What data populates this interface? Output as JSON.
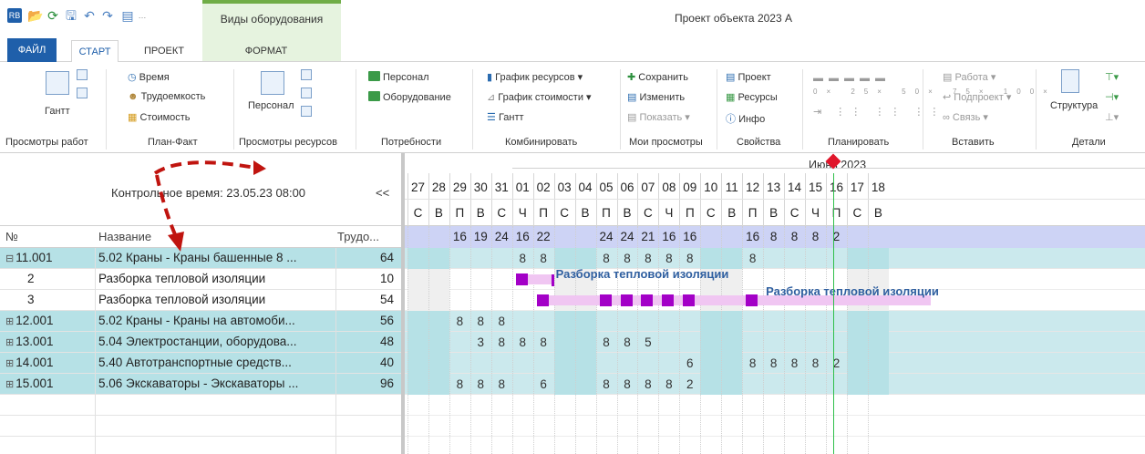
{
  "title_bar": {
    "context_tab_group": "Виды оборудования",
    "document_title": "Проект объекта 2023 А"
  },
  "tabs": [
    "ФАЙЛ",
    "СТАРТ",
    "ПРОЕКТ",
    "ФОРМАТ"
  ],
  "ribbon": {
    "work_views": {
      "gantt": "Гантт",
      "group": "Просмотры работ"
    },
    "plan_fact": {
      "time": "Время",
      "labor": "Трудоемкость",
      "cost": "Стоимость",
      "group": "План-Факт"
    },
    "resource_views": {
      "personnel": "Персонал",
      "group": "Просмотры ресурсов"
    },
    "needs": {
      "personnel": "Персонал",
      "equipment": "Оборудование",
      "group": "Потребности"
    },
    "combine": {
      "resource_chart": "График ресурсов",
      "cost_chart": "График стоимости",
      "gantt": "Гантт",
      "group": "Комбинировать"
    },
    "my_views": {
      "save": "Сохранить",
      "edit": "Изменить",
      "show": "Показать",
      "group": "Мои просмотры"
    },
    "properties": {
      "project": "Проект",
      "resources": "Ресурсы",
      "info": "Инфо",
      "group": "Свойства"
    },
    "planning": {
      "percents": [
        "0×",
        "25×",
        "50×",
        "75×",
        "100×"
      ],
      "group": "Планировать"
    },
    "insert": {
      "task": "Работа",
      "subproject": "Подпроект",
      "link": "Связь",
      "group": "Вставить"
    },
    "details": {
      "structure": "Структура",
      "group": "Детали"
    }
  },
  "grid_header": {
    "control_time": "Контрольное время: 23.05.23 08:00",
    "collapse": "<<",
    "col_num": "№",
    "col_name": "Название",
    "col_labor": "Трудо...",
    "month": "Июнь 2023"
  },
  "rows": [
    {
      "num": "11.001",
      "name": "5.02 Краны - Краны башенные 8 ...",
      "labor": "64",
      "group": true
    },
    {
      "num": "2",
      "name": "Разборка тепловой изоляции",
      "labor": "10",
      "group": false
    },
    {
      "num": "3",
      "name": "Разборка тепловой изоляции",
      "labor": "54",
      "group": false
    },
    {
      "num": "12.001",
      "name": "5.02 Краны - Краны на автомоби...",
      "labor": "56",
      "group": true
    },
    {
      "num": "13.001",
      "name": "5.04 Электростанции, оборудова...",
      "labor": "48",
      "group": true
    },
    {
      "num": "14.001",
      "name": "5.40 Автотранспортные средств...",
      "labor": "40",
      "group": true
    },
    {
      "num": "15.001",
      "name": "5.06 Экскаваторы - Экскаваторы ...",
      "labor": "96",
      "group": true
    }
  ],
  "days": [
    {
      "d": "27",
      "w": "С",
      "we": true
    },
    {
      "d": "28",
      "w": "В",
      "we": true
    },
    {
      "d": "29",
      "w": "П",
      "we": false
    },
    {
      "d": "30",
      "w": "В",
      "we": false
    },
    {
      "d": "31",
      "w": "С",
      "we": false
    },
    {
      "d": "01",
      "w": "Ч",
      "we": false
    },
    {
      "d": "02",
      "w": "П",
      "we": false
    },
    {
      "d": "03",
      "w": "С",
      "we": true
    },
    {
      "d": "04",
      "w": "В",
      "we": true
    },
    {
      "d": "05",
      "w": "П",
      "we": false
    },
    {
      "d": "06",
      "w": "В",
      "we": false
    },
    {
      "d": "07",
      "w": "С",
      "we": false
    },
    {
      "d": "08",
      "w": "Ч",
      "we": false
    },
    {
      "d": "09",
      "w": "П",
      "we": false
    },
    {
      "d": "10",
      "w": "С",
      "we": true
    },
    {
      "d": "11",
      "w": "В",
      "we": true
    },
    {
      "d": "12",
      "w": "П",
      "we": false
    },
    {
      "d": "13",
      "w": "В",
      "we": false
    },
    {
      "d": "14",
      "w": "С",
      "we": false
    },
    {
      "d": "15",
      "w": "Ч",
      "we": false
    },
    {
      "d": "16",
      "w": "П",
      "we": false
    },
    {
      "d": "17",
      "w": "С",
      "we": true
    },
    {
      "d": "18",
      "w": "В",
      "we": true
    }
  ],
  "totals": [
    "",
    "",
    "16",
    "19",
    "24",
    "16",
    "22",
    "",
    "",
    "24",
    "24",
    "21",
    "16",
    "16",
    "",
    "",
    "16",
    "8",
    "8",
    "8",
    "2",
    "",
    ""
  ],
  "row_values": [
    [
      "",
      "",
      "",
      "",
      "",
      "8",
      "8",
      "",
      "",
      "8",
      "8",
      "8",
      "8",
      "8",
      "",
      "",
      "8",
      "",
      "",
      "",
      "",
      "",
      ""
    ],
    [],
    [],
    [
      "",
      "",
      "8",
      "8",
      "8",
      "",
      "",
      "",
      "",
      "",
      "",
      "",
      "",
      "",
      "",
      "",
      "",
      "",
      "",
      "",
      "",
      "",
      ""
    ],
    [
      "",
      "",
      "",
      "3",
      "8",
      "8",
      "8",
      "",
      "",
      "8",
      "8",
      "5",
      "",
      "",
      "",
      "",
      "",
      "",
      "",
      "",
      "",
      "",
      ""
    ],
    [
      "",
      "",
      "",
      "",
      "",
      "",
      "",
      "",
      "",
      "",
      "",
      "",
      "",
      "6",
      "",
      "",
      "8",
      "8",
      "8",
      "8",
      "2",
      "",
      ""
    ],
    [
      "",
      "",
      "8",
      "8",
      "8",
      "",
      "6",
      "",
      "",
      "8",
      "8",
      "8",
      "8",
      "2",
      "",
      "",
      "",
      "",
      "",
      "",
      "",
      "",
      ""
    ]
  ],
  "bar_labels": [
    "Разборка тепловой изоляции",
    "Разборка тепловой изоляции"
  ],
  "colors": {
    "group_row": "#b6e1e6",
    "totals_row": "#cdd3f5",
    "bar_light": "#f0c6f2",
    "bar_dark": "#a300c7",
    "today_line": "#2fbf4a",
    "marker": "#e0162b"
  }
}
